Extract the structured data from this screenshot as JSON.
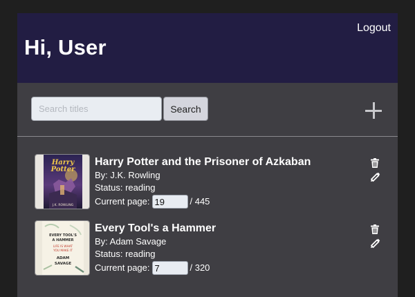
{
  "header": {
    "greeting": "Hi, User",
    "logout_label": "Logout"
  },
  "toolbar": {
    "search_placeholder": "Search titles",
    "search_value": "",
    "search_label": "Search",
    "add_icon": "plus-icon"
  },
  "books": [
    {
      "title": "Harry Potter and the Prisoner of Azkaban",
      "author": "By: J.K. Rowling",
      "status": "Status: reading",
      "current_page_label": "Current page:",
      "current_page": "19",
      "total_pages": "/ 445",
      "cover_text": {
        "title_line1": "Harry",
        "title_line2": "Potter",
        "author": "J.K. ROWLING"
      },
      "delete_icon": "trash-icon",
      "edit_icon": "pencil-icon"
    },
    {
      "title": "Every Tool's a Hammer",
      "author": "By: Adam Savage",
      "status": "Status: reading",
      "current_page_label": "Current page:",
      "current_page": "7",
      "total_pages": "/ 320",
      "cover_text": {
        "line1": "EVERY TOOL'S",
        "line2": "A HAMMER",
        "line3": "LIFE IS WHAT",
        "line4": "YOU MAKE IT",
        "line5": "ADAM",
        "line6": "SAVAGE"
      },
      "delete_icon": "trash-icon",
      "edit_icon": "pencil-icon"
    }
  ],
  "colors": {
    "page_background": "#1f1f1f",
    "panel": "#3f3e43",
    "header": "#221d43",
    "text": "#ffffff"
  }
}
